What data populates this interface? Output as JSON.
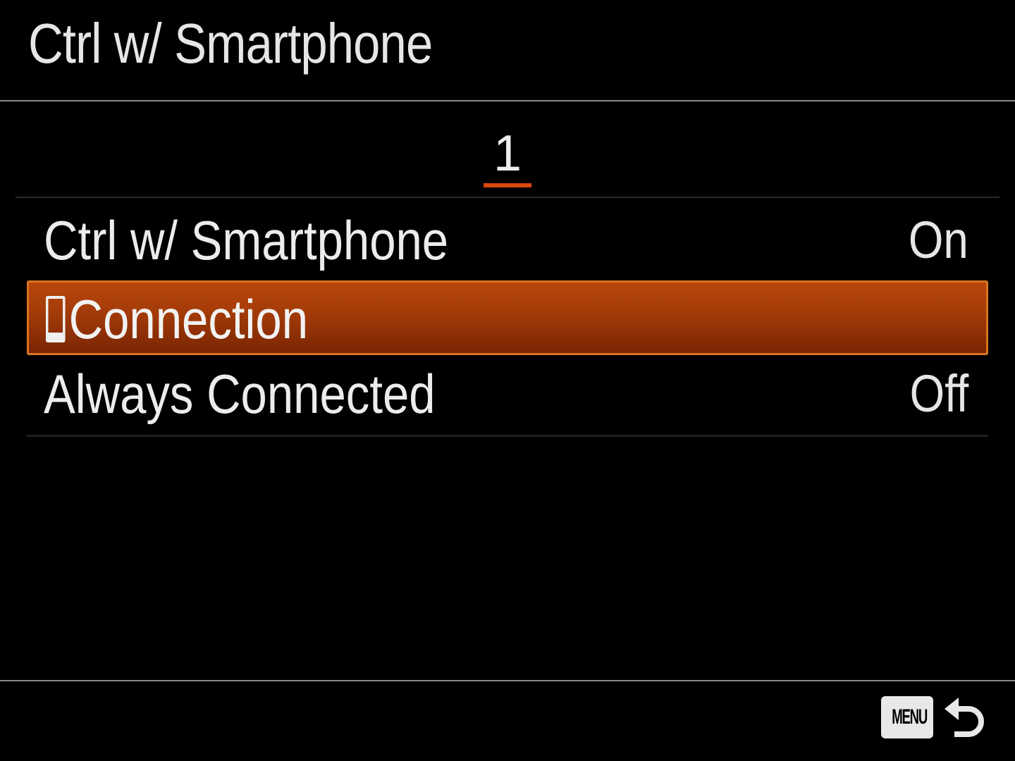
{
  "header": {
    "title": "Ctrl w/ Smartphone"
  },
  "tabs": {
    "active_page": "1"
  },
  "menu": {
    "items": [
      {
        "label": "Ctrl w/ Smartphone",
        "value": "On",
        "selected": false
      },
      {
        "label": "Connection",
        "icon": "smartphone-icon",
        "value": "",
        "selected": true
      },
      {
        "label": "Always Connected",
        "value": "Off",
        "selected": false
      }
    ]
  },
  "footer": {
    "menu_key_label": "MENU",
    "return_icon": "return-arrow-icon"
  },
  "colors": {
    "background": "#000000",
    "selection": "#a23a08",
    "selection_border": "#d8741f",
    "tab_underline": "#d9480f",
    "text": "#e6e6e6"
  }
}
